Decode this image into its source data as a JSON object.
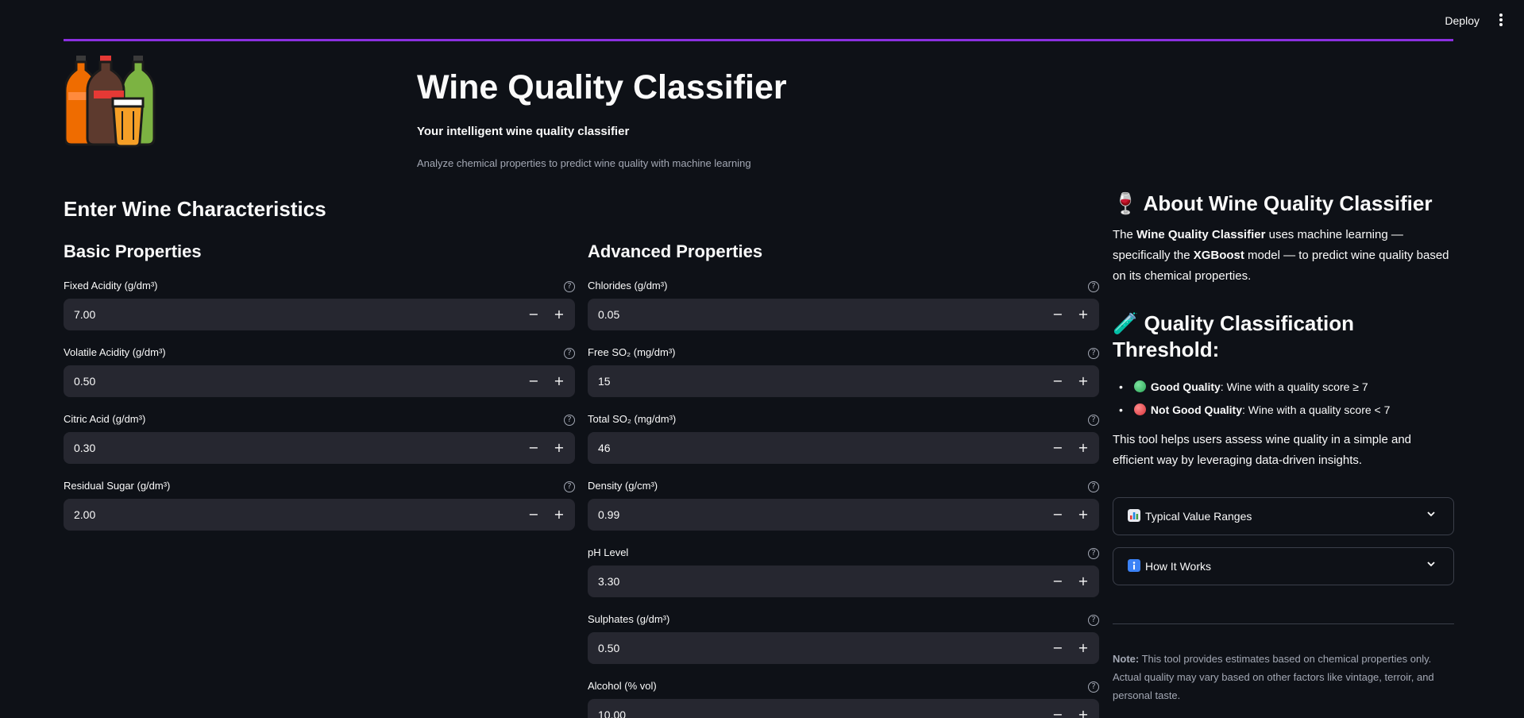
{
  "topbar": {
    "deploy_label": "Deploy",
    "menu_icon": "kebab-menu-icon"
  },
  "colors": {
    "accent": "#8b2fe0",
    "background": "#0e1117",
    "input_bg": "#262730",
    "muted": "#a3a8b4"
  },
  "hero": {
    "logo_icon": "bottles-and-glass-icon",
    "title": "Wine Quality Classifier",
    "subtitle": "Your intelligent wine quality classifier",
    "description": "Analyze chemical properties to predict wine quality with machine learning"
  },
  "main": {
    "title": "Enter Wine Characteristics"
  },
  "basic": {
    "title": "Basic Properties",
    "fields": [
      {
        "label": "Fixed Acidity (g/dm³)",
        "value": "7.00"
      },
      {
        "label": "Volatile Acidity (g/dm³)",
        "value": "0.50"
      },
      {
        "label": "Citric Acid (g/dm³)",
        "value": "0.30"
      },
      {
        "label": "Residual Sugar (g/dm³)",
        "value": "2.00"
      }
    ]
  },
  "advanced": {
    "title": "Advanced Properties",
    "fields": [
      {
        "label": "Chlorides (g/dm³)",
        "value": "0.05"
      },
      {
        "label": "Free SO₂ (mg/dm³)",
        "value": "15"
      },
      {
        "label": "Total SO₂ (mg/dm³)",
        "value": "46"
      },
      {
        "label": "Density (g/cm³)",
        "value": "0.99"
      },
      {
        "label": "pH Level",
        "value": "3.30"
      },
      {
        "label": "Sulphates (g/dm³)",
        "value": "0.50"
      },
      {
        "label": "Alcohol (% vol)",
        "value": "10.00"
      }
    ]
  },
  "controls": {
    "help_glyph": "?",
    "minus_glyph": "−",
    "plus_glyph": "+"
  },
  "sidebar": {
    "about_icon": "🍷",
    "about_title": "About Wine Quality Classifier",
    "about_p1_a": "The ",
    "about_p1_b": "Wine Quality Classifier",
    "about_p1_c": " uses machine learning — specifically the ",
    "about_p1_d": "XGBoost",
    "about_p1_e": " model — to predict wine quality based on its chemical properties.",
    "threshold_icon": "🧪",
    "threshold_title": "Quality Classification Threshold:",
    "good_label": "Good Quality",
    "good_text": ": Wine with a quality score ≥ 7",
    "bad_label": "Not Good Quality",
    "bad_text": ": Wine with a quality score < 7",
    "tool_text": "This tool helps users assess wine quality in a simple and efficient way by leveraging data-driven insights.",
    "expanders": [
      {
        "label": "Typical Value Ranges",
        "icon": "bar-chart-icon"
      },
      {
        "label": "How It Works",
        "icon": "info-icon"
      }
    ],
    "note_label": "Note:",
    "note_text": " This tool provides estimates based on chemical properties only. Actual quality may vary based on other factors like vintage, terroir, and personal taste."
  }
}
